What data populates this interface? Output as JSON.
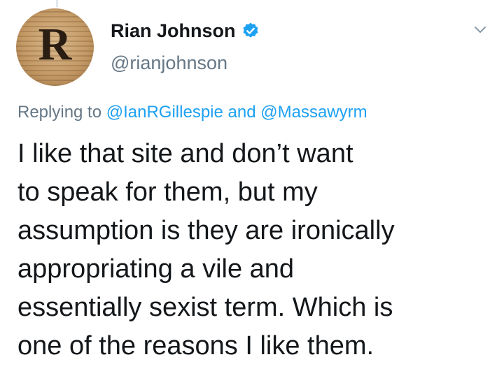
{
  "tweet": {
    "author": {
      "initial": "R",
      "display_name": "Rian Johnson",
      "handle": "@rianjohnson",
      "verified_icon": "verified-badge-icon"
    },
    "menu_icon": "chevron-down-icon",
    "reply_context": {
      "prefix": "Replying to",
      "mention_1": "@IanRGillespie",
      "conjunction": "and",
      "mention_2": "@Massawyrm"
    },
    "text_lines": [
      "I like that site and don’t want",
      "to speak for them, but my",
      "assumption is they are ironically",
      "appropriating a vile and",
      "essentially sexist term. Which is",
      "one of the reasons I like them."
    ]
  },
  "colors": {
    "text": "#14171a",
    "secondary": "#657786",
    "link": "#1da1f2",
    "verified": "#1da1f2"
  }
}
